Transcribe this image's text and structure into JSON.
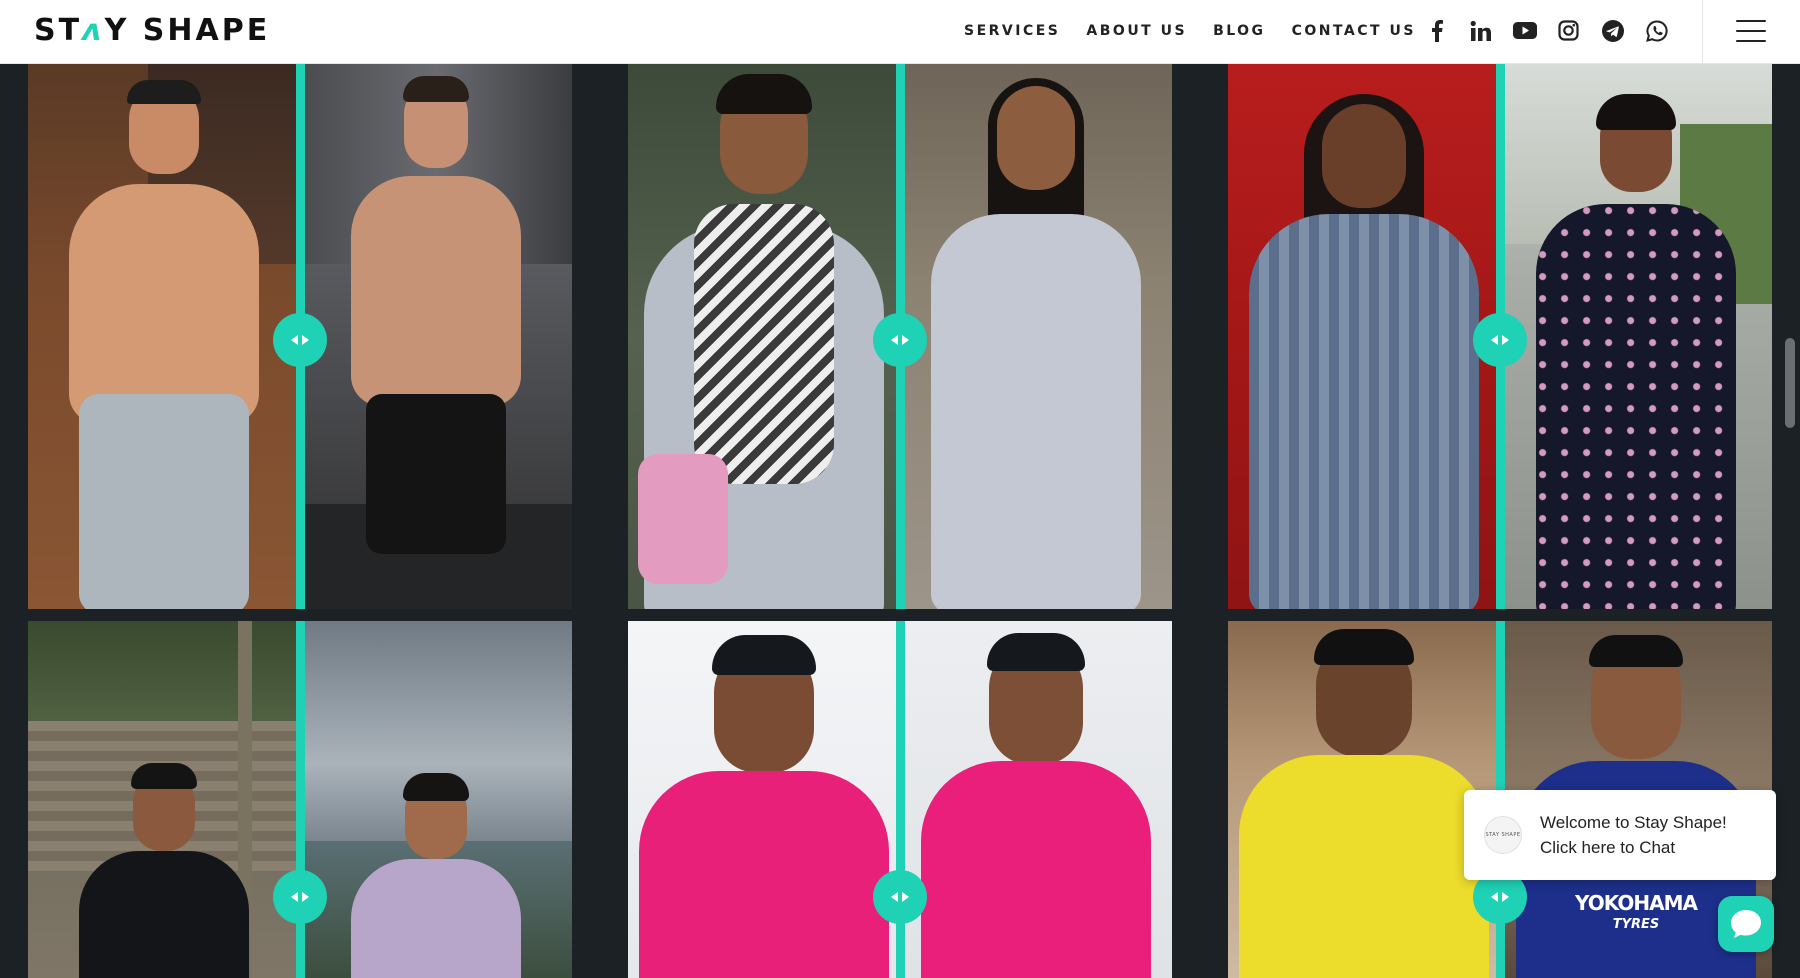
{
  "brand": {
    "logo_text_pre": "ST",
    "logo_text_swoosh": "ʌ",
    "logo_text_post": "Y SHAPE",
    "accent": "#1fd1b5"
  },
  "nav": {
    "services": "SERVICES",
    "about": "ABOUT US",
    "blog": "BLOG",
    "contact": "CONTACT US"
  },
  "social_icons": [
    "facebook-icon",
    "linkedin-icon",
    "youtube-icon",
    "instagram-icon",
    "telegram-icon",
    "whatsapp-icon"
  ],
  "gallery": {
    "tiles": [
      {
        "name": "transformation-1",
        "before": "before-photo-shirtless-man",
        "after": "after-photo-shirtless-man-gym"
      },
      {
        "name": "transformation-2",
        "before": "before-photo-woman-scarf",
        "after": "after-photo-woman-kurta"
      },
      {
        "name": "transformation-3",
        "before": "before-photo-woman-blue-kurta",
        "after": "after-photo-woman-floral-dress"
      },
      {
        "name": "transformation-4",
        "before": "before-photo-man-black-hoodie",
        "after": "after-photo-man-lavender-sweater"
      },
      {
        "name": "transformation-5",
        "before": "before-photo-man-pink-shirt",
        "after": "after-photo-man-pink-shirt"
      },
      {
        "name": "transformation-6",
        "before": "before-photo-man-yellow-tshirt",
        "after": "after-photo-man-blue-jersey"
      }
    ]
  },
  "chat": {
    "avatar_text": "STAY SHAPE",
    "line1": "Welcome to Stay Shape!",
    "line2": "Click here to Chat"
  },
  "jersey_text": "YOKOHAMA",
  "jersey_sub": "TYRES"
}
